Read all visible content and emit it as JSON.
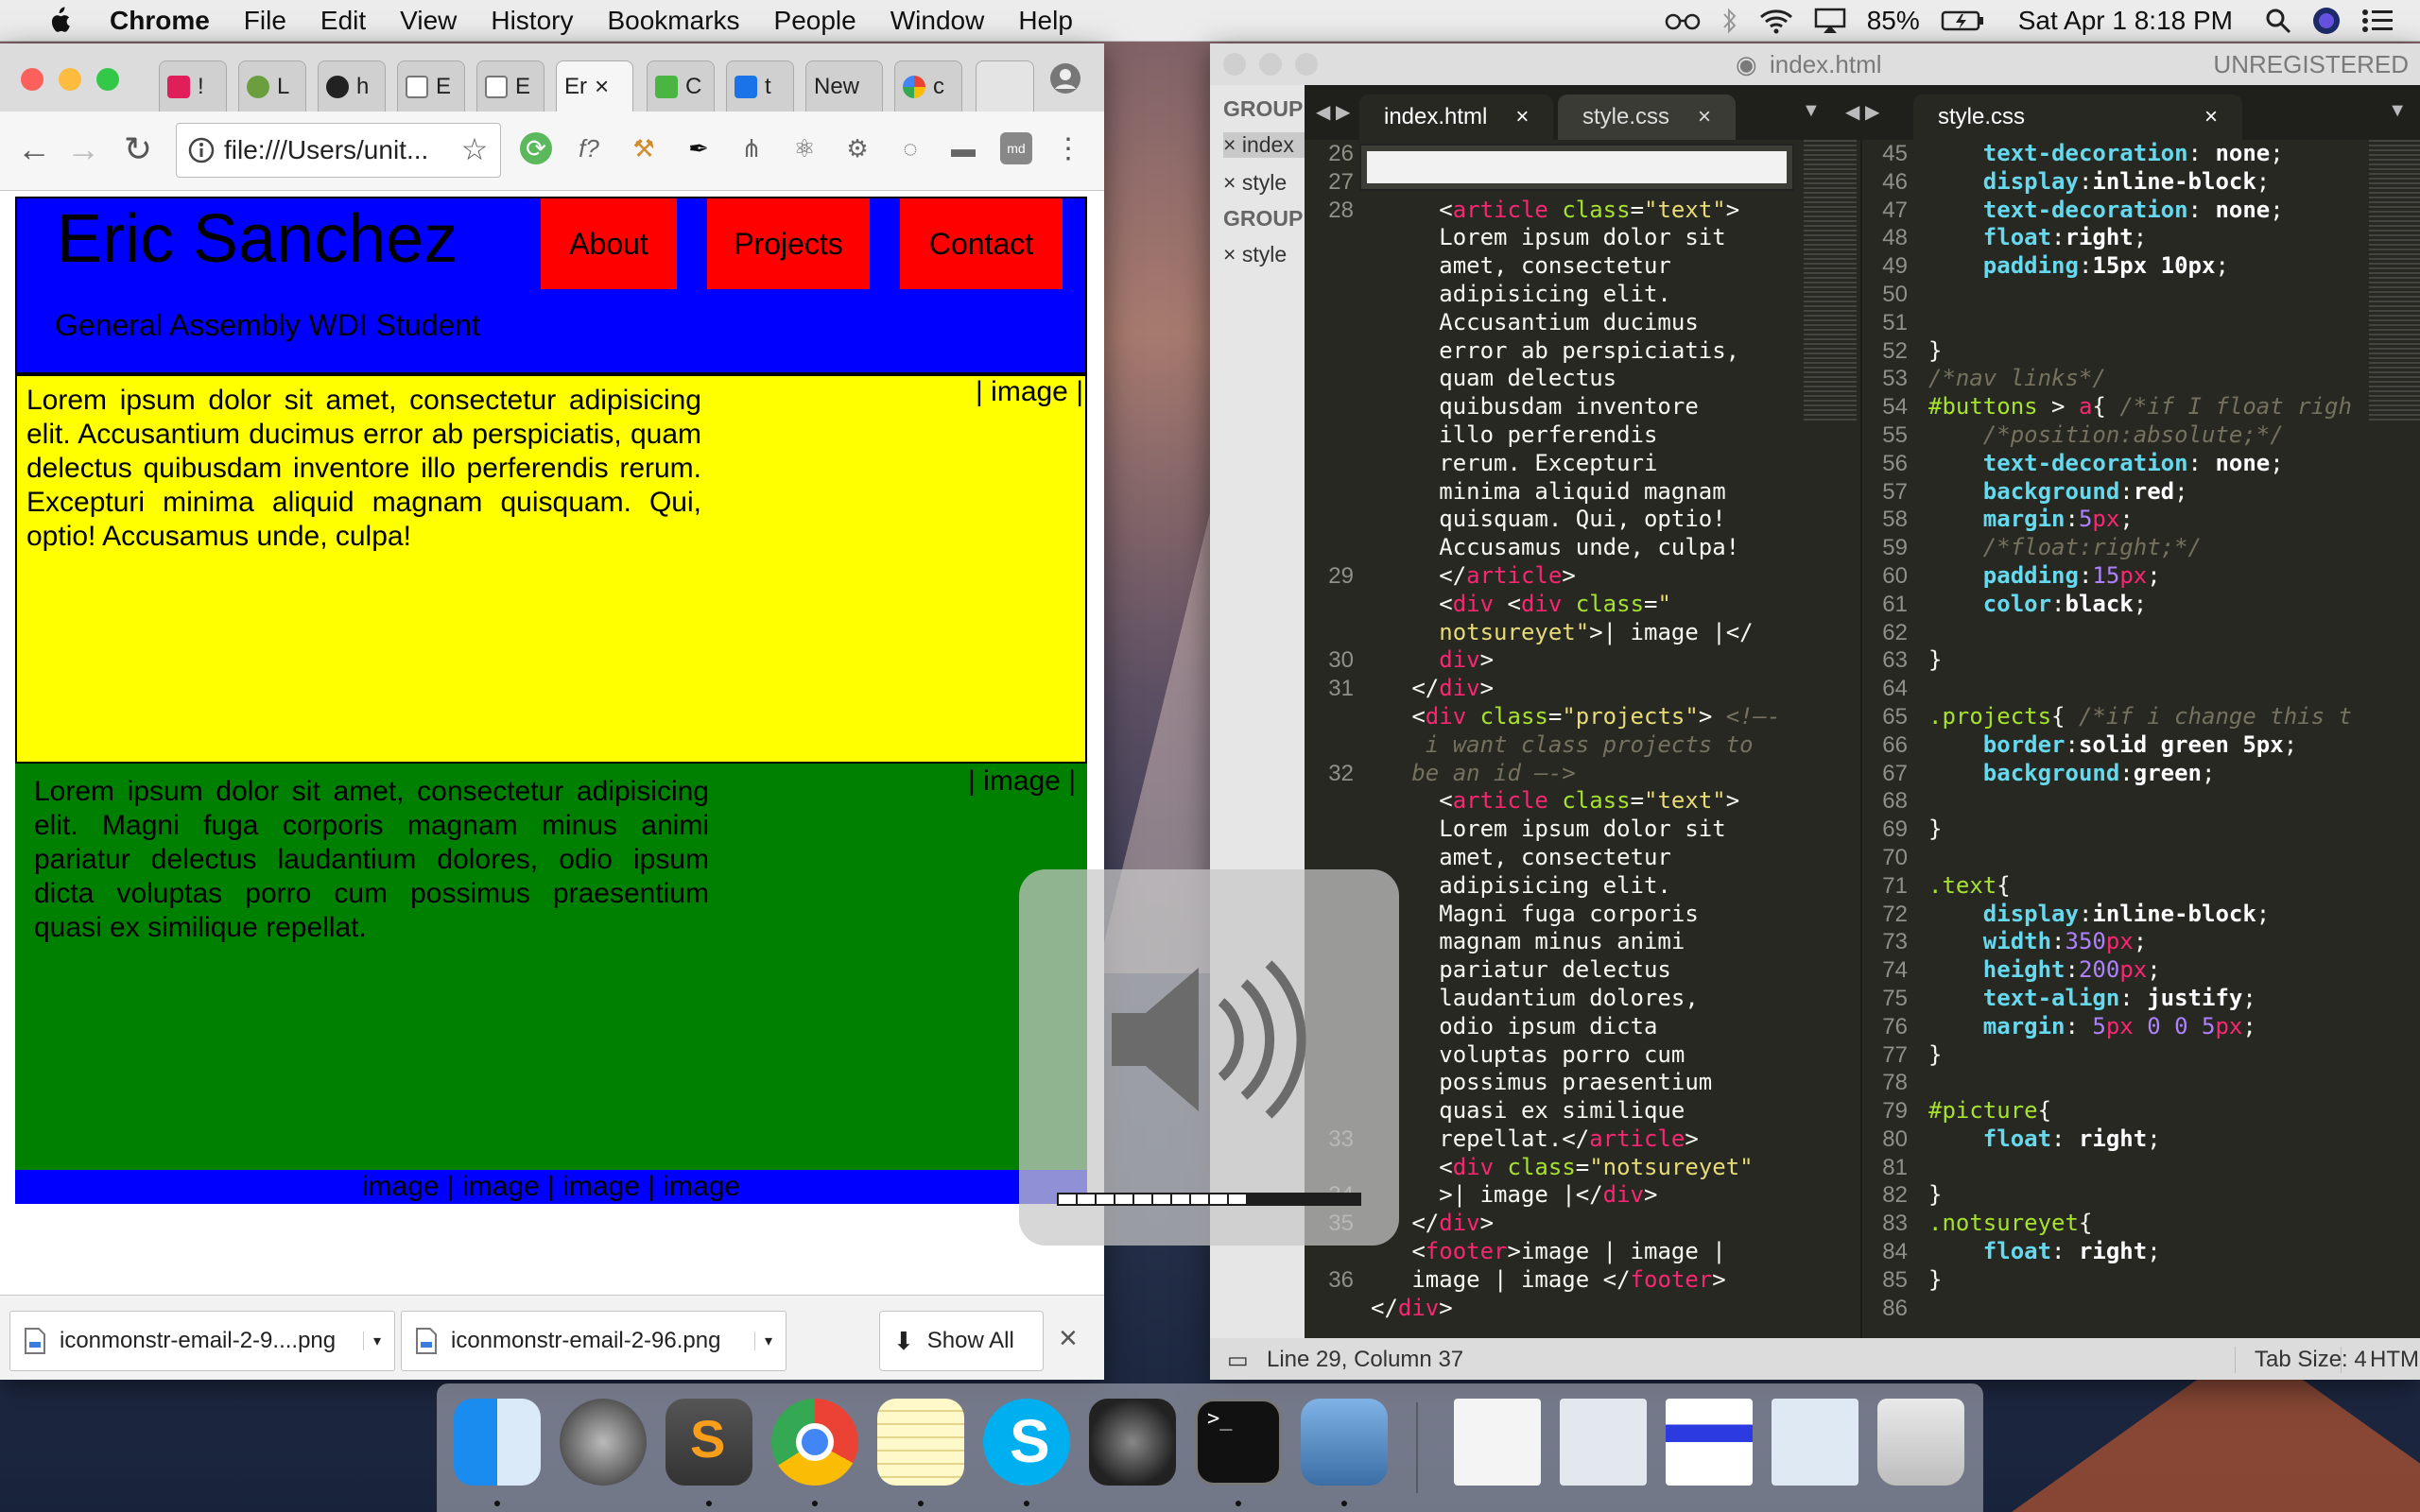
{
  "menubar": {
    "app_name": "Chrome",
    "menus": [
      "File",
      "Edit",
      "View",
      "History",
      "Bookmarks",
      "People",
      "Window",
      "Help"
    ],
    "battery": "85%",
    "datetime": "Sat Apr 1  8:18 PM"
  },
  "chrome": {
    "tabs": [
      {
        "label": "!",
        "icon": "hash-icon"
      },
      {
        "label": "L",
        "icon": "circle-icon"
      },
      {
        "label": "h",
        "icon": "github-icon"
      },
      {
        "label": "E",
        "icon": "document-icon"
      },
      {
        "label": "E",
        "icon": "document-icon"
      },
      {
        "label": "Er",
        "icon": "none",
        "active": true
      },
      {
        "label": "C",
        "icon": "green-icon"
      },
      {
        "label": "t",
        "icon": "blue-icon"
      },
      {
        "label": "New",
        "icon": "none"
      },
      {
        "label": "c",
        "icon": "google-icon"
      }
    ],
    "address": "file:///Users/unit...",
    "downloads": [
      {
        "name": "iconmonstr-email-2-9....png"
      },
      {
        "name": "iconmonstr-email-2-96.png"
      }
    ],
    "show_all": "Show All"
  },
  "site": {
    "name": "Eric Sanchez",
    "subtitle": "General Assembly WDI Student",
    "nav": [
      "About",
      "Projects",
      "Contact"
    ],
    "text_article": "Lorem ipsum dolor sit amet, consectetur adipisicing elit. Accusantium ducimus error ab perspiciatis, quam delectus quibusdam inventore illo perferendis rerum. Excepturi minima aliquid magnam quisquam. Qui, optio! Accusamus unde, culpa!",
    "image_label_1": "| image |",
    "projects_article": "Lorem ipsum dolor sit amet, consectetur adipisicing elit. Magni fuga corporis magnam minus animi pariatur delectus laudantium dolores, odio ipsum dicta voluptas porro cum possimus praesentium quasi ex similique repellat.",
    "image_label_2": "| image |",
    "footer": "image | image | image | image"
  },
  "sublime": {
    "title": "index.html",
    "unregistered": "UNREGISTERED",
    "sidebar": {
      "group1": "GROUP",
      "files1": [
        "index",
        "style"
      ],
      "group2": "GROUP",
      "files2": [
        "style"
      ]
    },
    "tabs_left": [
      "index.html",
      "style.css"
    ],
    "tab_right": "style.css",
    "status_position": "Line 29, Column 37",
    "tab_size": "Tab Size: 4",
    "syntax": "HTML",
    "left_line_numbers": [
      "26",
      "27",
      "28",
      "",
      "",
      "",
      "",
      "",
      "",
      "",
      "",
      "",
      "",
      "",
      "",
      "29",
      "",
      "",
      "30",
      "31",
      "",
      "",
      "32",
      "",
      "",
      "",
      "",
      "",
      "",
      "",
      "",
      "",
      "",
      "",
      "",
      "",
      "33",
      "",
      "34",
      "35",
      "",
      "36"
    ],
    "right_line_numbers": [
      "45",
      "46",
      "47",
      "48",
      "49",
      "50",
      "51",
      "52",
      "53",
      "54",
      "55",
      "56",
      "57",
      "58",
      "59",
      "60",
      "61",
      "62",
      "63",
      "64",
      "65",
      "66",
      "67",
      "68",
      "69",
      "70",
      "71",
      "72",
      "73",
      "74",
      "75",
      "76",
      "77",
      "78",
      "79",
      "80",
      "81",
      "82",
      "83",
      "84",
      "85",
      "86"
    ]
  },
  "dock": {
    "apps": [
      "finder-icon",
      "launchpad-icon",
      "sublime-icon",
      "chrome-icon",
      "notes-icon",
      "skype-icon",
      "disk-utility-icon",
      "terminal-icon",
      "preview-icon",
      "stack-icon",
      "stack-icon",
      "stack-icon",
      "stack-icon",
      "trash-icon"
    ]
  },
  "colors": {
    "site_header": "#0000ff",
    "nav_button": "#ff0000",
    "text_section": "#ffff00",
    "projects_section": "#008000",
    "editor_bg": "#272822"
  }
}
